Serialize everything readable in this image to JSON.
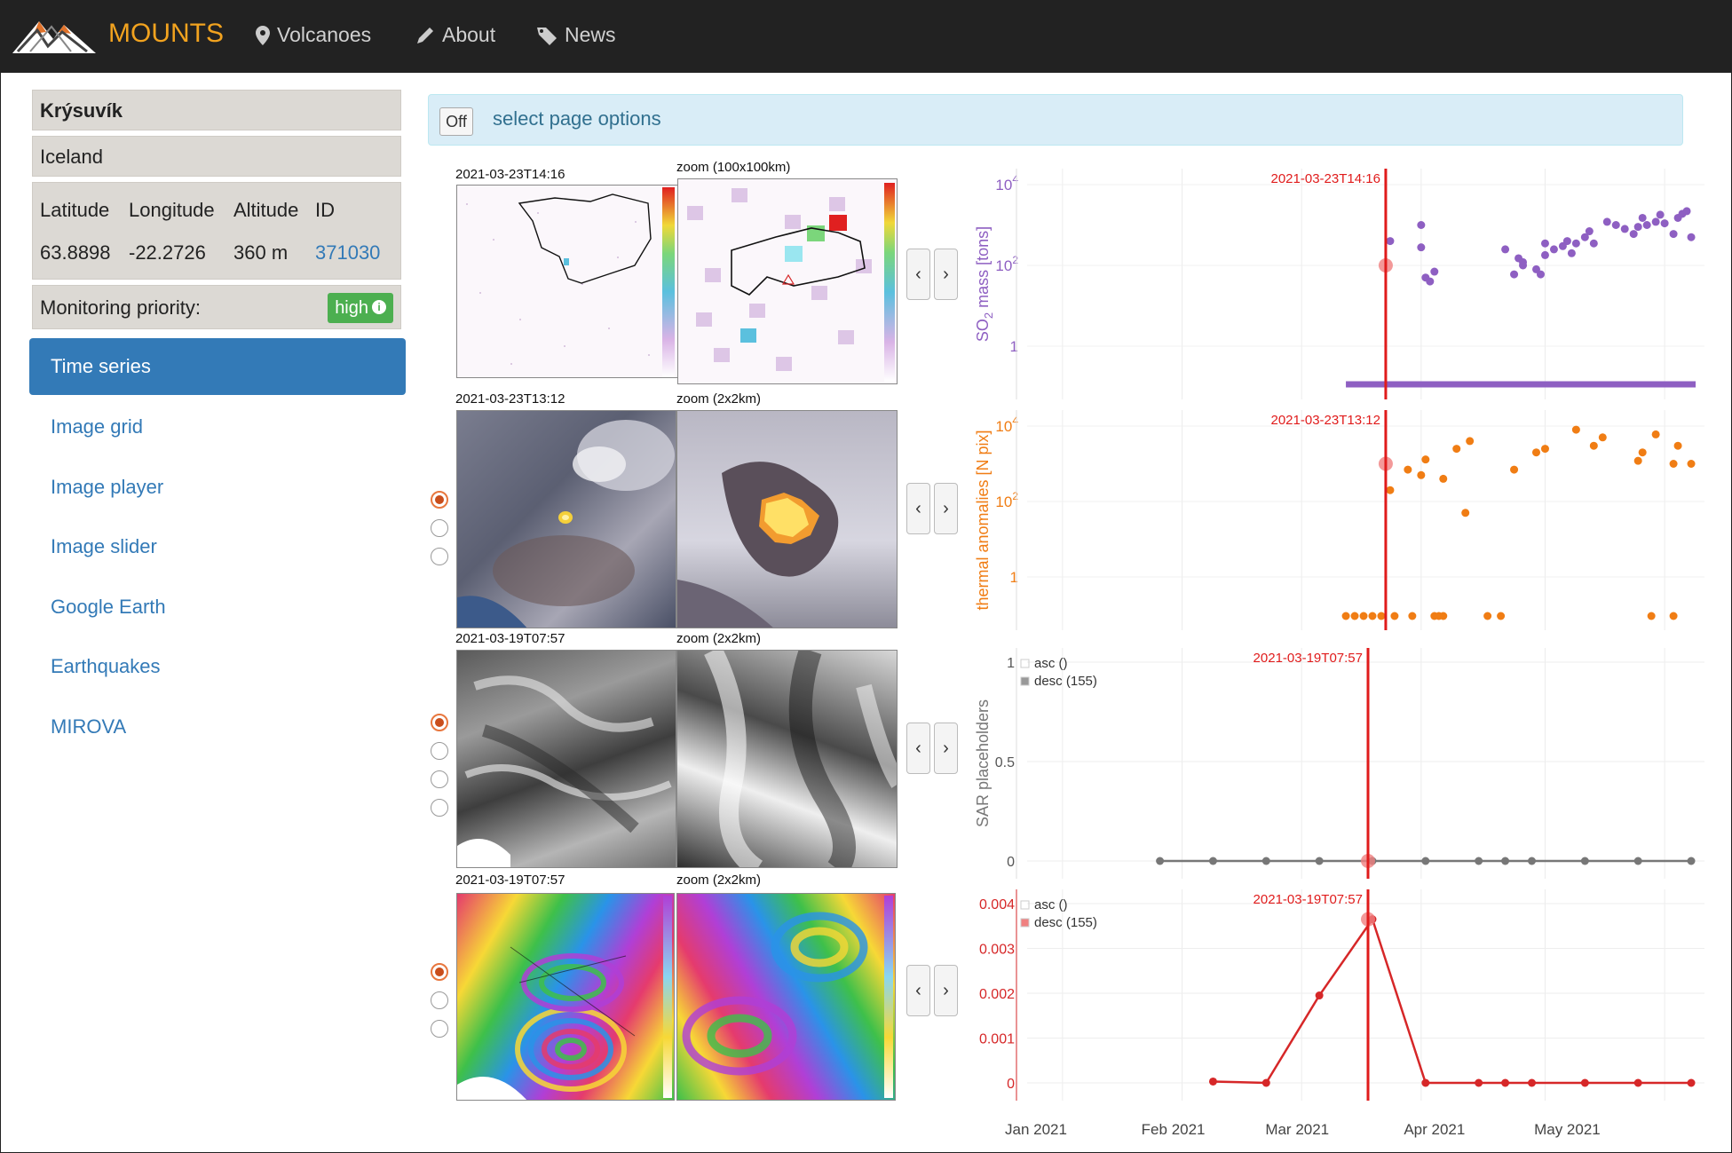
{
  "navbar": {
    "brand": "MOUNTS",
    "items": [
      {
        "label": "Volcanoes",
        "icon": "map-marker-icon"
      },
      {
        "label": "About",
        "icon": "pencil-icon"
      },
      {
        "label": "News",
        "icon": "tag-icon"
      }
    ]
  },
  "sidebar": {
    "volcano_name": "Krýsuvík",
    "country": "Iceland",
    "headers": [
      "Latitude",
      "Longitude",
      "Altitude",
      "ID"
    ],
    "values": {
      "latitude": "63.8898",
      "longitude": "-22.2726",
      "altitude": "360 m",
      "id": "371030"
    },
    "priority_label": "Monitoring priority:",
    "priority_value": "high",
    "menu": [
      {
        "label": "Time series",
        "active": true
      },
      {
        "label": "Image grid"
      },
      {
        "label": "Image player"
      },
      {
        "label": "Image slider"
      },
      {
        "label": "Google Earth"
      },
      {
        "label": "Earthquakes"
      },
      {
        "label": "MIROVA"
      }
    ]
  },
  "options": {
    "toggle_label": "Off",
    "text": "select page options"
  },
  "image_rows": [
    {
      "left_label": "2021-03-23T14:16",
      "right_label": "zoom (100x100km)",
      "radios": 0,
      "checked": -1
    },
    {
      "left_label": "2021-03-23T13:12",
      "right_label": "zoom (2x2km)",
      "radios": 3,
      "checked": 0
    },
    {
      "left_label": "2021-03-19T07:57",
      "right_label": "zoom (2x2km)",
      "radios": 4,
      "checked": 0
    },
    {
      "left_label": "2021-03-19T07:57",
      "right_label": "zoom (2x2km)",
      "radios": 3,
      "checked": 0
    }
  ],
  "colors": {
    "so2": "#8e5fc2",
    "thermal": "#f07d14",
    "sar": "#777777",
    "insar": "#d62728",
    "marker": "#e01b1b",
    "link": "#337ab7",
    "active": "#337ab7",
    "brand": "#f2a31f"
  },
  "chart_data": [
    {
      "type": "scatter",
      "ylabel": "SO2 mass [tons]",
      "yscale": "log",
      "ytick_labels": [
        "10^4",
        "10^2",
        "1"
      ],
      "marker_label": "2021-03-23T14:16",
      "marker_date": "2021-03-23",
      "x": [
        "2021-03-23",
        "2021-03-24",
        "2021-03-31",
        "2021-03-31",
        "2021-04-01",
        "2021-04-02",
        "2021-04-03",
        "2021-04-19",
        "2021-04-21",
        "2021-04-22",
        "2021-04-23",
        "2021-04-23",
        "2021-04-26",
        "2021-04-27",
        "2021-04-28",
        "2021-04-28",
        "2021-04-30",
        "2021-05-02",
        "2021-05-03",
        "2021-05-04",
        "2021-05-05",
        "2021-05-07",
        "2021-05-08",
        "2021-05-09",
        "2021-05-12",
        "2021-05-14",
        "2021-05-16",
        "2021-05-18",
        "2021-05-19",
        "2021-05-20",
        "2021-05-21",
        "2021-05-23",
        "2021-05-24",
        "2021-05-25",
        "2021-05-27",
        "2021-05-28",
        "2021-05-29",
        "2021-05-30",
        "2021-05-31"
      ],
      "y": [
        100,
        400,
        1000,
        280,
        50,
        40,
        70,
        250,
        60,
        150,
        100,
        120,
        80,
        60,
        350,
        180,
        250,
        300,
        400,
        200,
        350,
        500,
        700,
        350,
        1200,
        1000,
        800,
        600,
        900,
        1500,
        1000,
        1200,
        1800,
        1100,
        600,
        1500,
        1900,
        2200,
        500
      ],
      "zero_band": {
        "start": "2021-03-14",
        "end": "2021-06-01",
        "label": "0"
      }
    },
    {
      "type": "scatter",
      "ylabel": "thermal anomalies [N pix]",
      "yscale": "log",
      "ytick_labels": [
        "10^4",
        "10^2",
        "1"
      ],
      "marker_label": "2021-03-23T13:12",
      "marker_date": "2021-03-23",
      "x": [
        "2021-03-23",
        "2021-03-24",
        "2021-03-28",
        "2021-03-31",
        "2021-04-01",
        "2021-04-05",
        "2021-04-08",
        "2021-04-10",
        "2021-04-11",
        "2021-04-21",
        "2021-04-26",
        "2021-04-28",
        "2021-05-05",
        "2021-05-09",
        "2021-05-11",
        "2021-05-19",
        "2021-05-20",
        "2021-05-23",
        "2021-05-27",
        "2021-05-28",
        "2021-05-31"
      ],
      "y": [
        1000,
        200,
        700,
        500,
        1300,
        400,
        2500,
        50,
        4000,
        700,
        2000,
        2500,
        8000,
        3000,
        5000,
        1200,
        2000,
        6000,
        1000,
        3000,
        1000
      ],
      "near_zero_x": [
        "2021-03-14",
        "2021-03-16",
        "2021-03-18",
        "2021-03-20",
        "2021-03-22",
        "2021-03-25",
        "2021-03-29",
        "2021-04-03",
        "2021-04-04",
        "2021-04-05",
        "2021-04-15",
        "2021-04-18",
        "2021-05-22",
        "2021-05-27"
      ]
    },
    {
      "type": "line",
      "ylabel": "SAR placeholders",
      "ylim": [
        0,
        1
      ],
      "ytick_labels": [
        "1",
        "0.5",
        "0"
      ],
      "marker_label": "2021-03-19T07:57",
      "marker_date": "2021-03-19",
      "legend": [
        "asc ()",
        "desc (155)"
      ],
      "legend_position": "top-left",
      "series": [
        {
          "name": "desc (155)",
          "x": [
            "2021-01-31",
            "2021-02-12",
            "2021-02-24",
            "2021-03-08",
            "2021-03-20",
            "2021-04-01",
            "2021-04-13",
            "2021-04-19",
            "2021-04-25",
            "2021-05-07",
            "2021-05-19",
            "2021-05-31"
          ],
          "y": [
            0,
            0,
            0,
            0,
            0,
            0,
            0,
            0,
            0,
            0,
            0,
            0
          ]
        }
      ]
    },
    {
      "type": "line",
      "ylim": [
        0,
        0.004
      ],
      "ytick_labels": [
        "0.004",
        "0.003",
        "0.002",
        "0.001",
        "0"
      ],
      "marker_label": "2021-03-19T07:57",
      "marker_date": "2021-03-19",
      "legend": [
        "asc ()",
        "desc (155)"
      ],
      "legend_position": "top-left",
      "series": [
        {
          "name": "desc (155)",
          "x": [
            "2021-02-12",
            "2021-02-24",
            "2021-03-08",
            "2021-03-20",
            "2021-04-01",
            "2021-04-13",
            "2021-04-19",
            "2021-04-25",
            "2021-05-07",
            "2021-05-19",
            "2021-05-31"
          ],
          "y": [
            3e-05,
            0,
            0.00195,
            0.00365,
            0,
            0,
            0,
            0,
            0,
            0,
            0
          ]
        }
      ],
      "xtick_labels": [
        "Jan 2021",
        "Feb 2021",
        "Mar 2021",
        "Apr 2021",
        "May 2021"
      ]
    }
  ]
}
